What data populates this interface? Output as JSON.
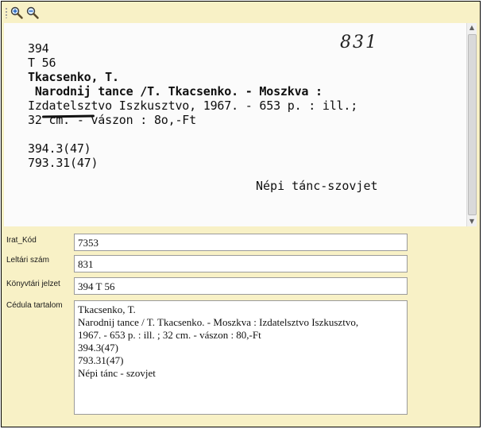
{
  "toolbar": {
    "icons": [
      "zoom-in-icon",
      "zoom-out-icon"
    ]
  },
  "card": {
    "line1": "394",
    "line2": "T 56",
    "line3": "Tkacsenko, T.",
    "line4": " Narodnij tance /T. Tkacsenko. - Moszkva :",
    "line5": "Izdatelsztvo Iszkusztvo, 1967. - 653 p. : ill.;",
    "line6": "32 cm. - vászon : 8o,-Ft",
    "line7": "394.3(47)",
    "line8": "793.31(47)",
    "handwritten": "831",
    "subject": "Népi tánc-szovjet"
  },
  "form": {
    "irat_kod_label": "Irat_Kód",
    "irat_kod_value": "7353",
    "leltari_label": "Leltári szám",
    "leltari_value": "831",
    "konyvtari_label": "Könyvtári jelzet",
    "konyvtari_value": "394 T 56",
    "cedula_label": "Cédula tartalom",
    "cedula_value": "Tkacsenko, T.\nNarodnij tance / T. Tkacsenko. - Moszkva : Izdatelsztvo Iszkusztvo,\n1967. - 653 p. : ill. ; 32 cm. - vászon : 80,-Ft\n394.3(47)\n793.31(47)\nNépi tánc - szovjet"
  },
  "colors": {
    "panel_bg": "#f8f1c6",
    "card_bg": "#fbfbfb"
  }
}
